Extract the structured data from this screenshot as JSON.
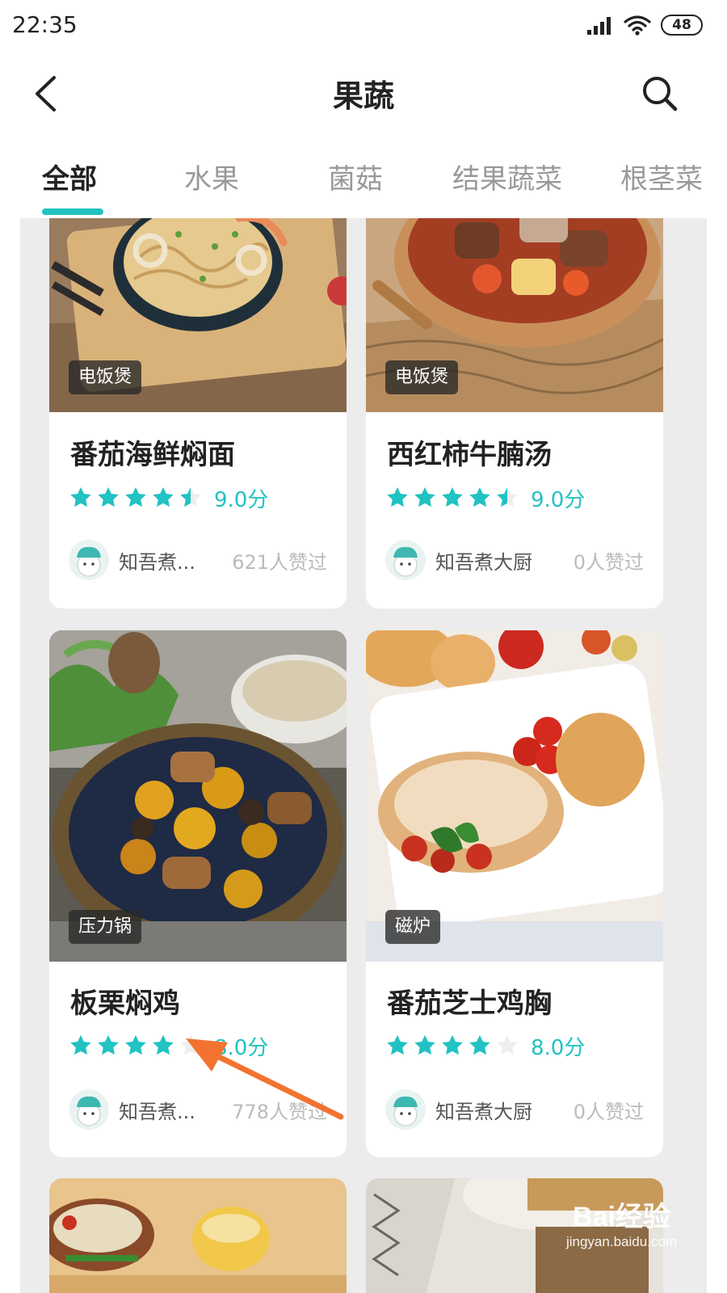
{
  "status_bar": {
    "time": "22:35",
    "battery": "48"
  },
  "header": {
    "title": "果蔬"
  },
  "tabs": [
    {
      "label": "全部",
      "active": true
    },
    {
      "label": "水果",
      "active": false
    },
    {
      "label": "菌菇",
      "active": false
    },
    {
      "label": "结果蔬菜",
      "active": false
    },
    {
      "label": "根茎菜",
      "active": false
    }
  ],
  "colors": {
    "accent": "#21c2c2",
    "star_empty": "#eeeeee",
    "annotation_arrow": "#f27330"
  },
  "recipes": [
    {
      "tag": "电饭煲",
      "title": "番茄海鲜焖面",
      "rating_stars": 4.5,
      "score": "9.0分",
      "author": "知吾煮...",
      "likes": "621人赞过"
    },
    {
      "tag": "电饭煲",
      "title": "西红柿牛腩汤",
      "rating_stars": 4.5,
      "score": "9.0分",
      "author": "知吾煮大厨",
      "likes": "0人赞过"
    },
    {
      "tag": "压力锅",
      "title": "板栗焖鸡",
      "rating_stars": 4,
      "score": "8.0分",
      "author": "知吾煮...",
      "likes": "778人赞过"
    },
    {
      "tag": "磁炉",
      "title": "番茄芝士鸡胸",
      "rating_stars": 4,
      "score": "8.0分",
      "author": "知吾煮大厨",
      "likes": "0人赞过"
    }
  ],
  "watermark": {
    "brand": "Bai经验",
    "url": "jingyan.baidu.com"
  }
}
